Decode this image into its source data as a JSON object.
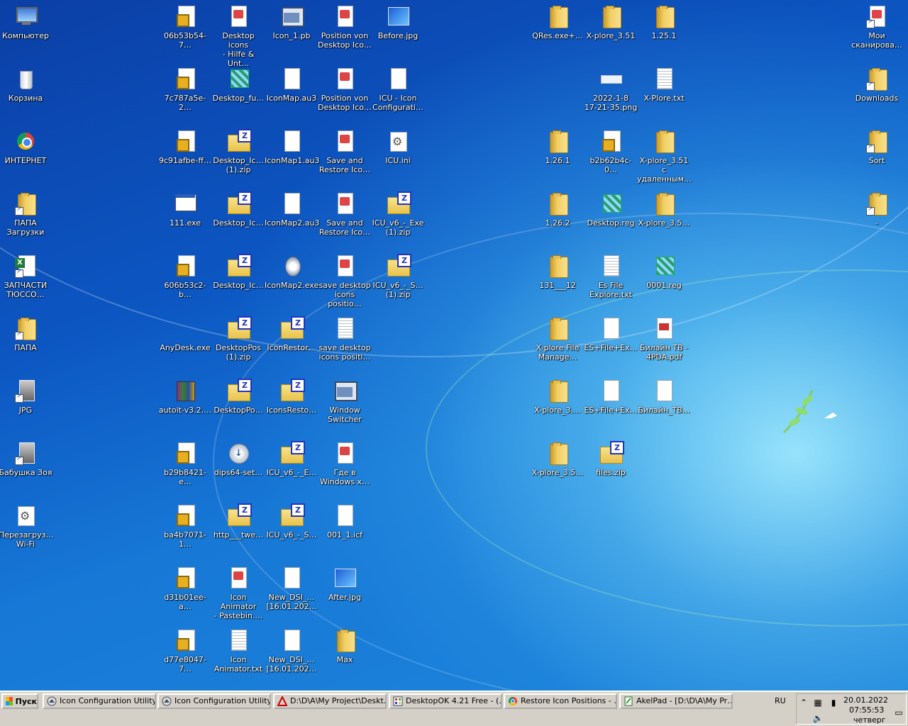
{
  "desktop": {
    "icons": [
      {
        "label": "Компьютер",
        "icon": "computer-icon"
      },
      {
        "label": "Корзина",
        "icon": "recycle-bin-icon"
      },
      {
        "label": "ИНТЕРНЕТ",
        "icon": "chrome-icon"
      },
      {
        "label": "ПАПА\nЗагрузки",
        "icon": "folder-shortcut-icon"
      },
      {
        "label": "ЗАПЧАСТИ\nТЮССО…",
        "icon": "excel-shortcut-icon"
      },
      {
        "label": "ПАПА",
        "icon": "folder-shortcut-icon"
      },
      {
        "label": "JPG",
        "icon": "photo-shortcut-icon"
      },
      {
        "label": "Бабушка Зоя",
        "icon": "photo-shortcut-icon"
      },
      {
        "label": "Перезагруз…\nWi-Fi",
        "icon": "gear-file-icon"
      },
      {
        "label": "06b53b54-7…",
        "icon": "package-icon"
      },
      {
        "label": "7c787a5e-2…",
        "icon": "package-icon"
      },
      {
        "label": "9c91afbe-ff…",
        "icon": "package-icon"
      },
      {
        "label": "111.exe",
        "icon": "exe-icon"
      },
      {
        "label": "606b53c2-b…",
        "icon": "package-icon"
      },
      {
        "label": "AnyDesk.exe",
        "icon": "none"
      },
      {
        "label": "autoit-v3.2.…",
        "icon": "winrar-icon"
      },
      {
        "label": "b29b8421-e…",
        "icon": "package-icon"
      },
      {
        "label": "ba4b7071-1…",
        "icon": "package-icon"
      },
      {
        "label": "d31b01ee-a…",
        "icon": "package-icon"
      },
      {
        "label": "d77e8047-7…",
        "icon": "package-icon"
      },
      {
        "label": "Desktop icons\n- Hilfe & Unt…",
        "icon": "document-icon"
      },
      {
        "label": "Desktop_fu…",
        "icon": "registry-icon"
      },
      {
        "label": "Desktop_Ic…\n(1).zip",
        "icon": "zip-icon"
      },
      {
        "label": "Desktop_Ic…",
        "icon": "zip-icon"
      },
      {
        "label": "Desktop_Ic…",
        "icon": "zip-icon"
      },
      {
        "label": "DesktopPos\n(1).zip",
        "icon": "zip-icon"
      },
      {
        "label": "DesktopPo…",
        "icon": "zip-icon"
      },
      {
        "label": "dips64-set…",
        "icon": "installer-disc-icon"
      },
      {
        "label": "http___twe…",
        "icon": "zip-icon"
      },
      {
        "label": "Icon Animator\n- Pastebin.…",
        "icon": "document-icon"
      },
      {
        "label": "Icon\nAnimator.txt",
        "icon": "text-file-icon"
      },
      {
        "label": "Icon_1.pb",
        "icon": "window-icon"
      },
      {
        "label": "IconMap.au3",
        "icon": "blank-file-icon"
      },
      {
        "label": "IconMap1.au3",
        "icon": "blank-file-icon"
      },
      {
        "label": "IconMap2.au3",
        "icon": "blank-file-icon"
      },
      {
        "label": "IconMap2.exe",
        "icon": "feather-exe-icon"
      },
      {
        "label": "IconRestor…",
        "icon": "zip-icon"
      },
      {
        "label": "IconsResto…",
        "icon": "zip-icon"
      },
      {
        "label": "ICU_v6_-_E…",
        "icon": "zip-icon"
      },
      {
        "label": "ICU_v6_-_S…",
        "icon": "zip-icon"
      },
      {
        "label": "New_DSI_…\n[16.01.202…",
        "icon": "blank-file-icon"
      },
      {
        "label": "New_DSI_…\n[16.01.202…",
        "icon": "blank-file-icon"
      },
      {
        "label": "Position von\nDesktop Ico…",
        "icon": "document-icon"
      },
      {
        "label": "Position von\nDesktop Ico…",
        "icon": "document-icon"
      },
      {
        "label": "Save and\nRestore Ico…",
        "icon": "document-icon"
      },
      {
        "label": "Save and\nRestore Ico…",
        "icon": "document-icon"
      },
      {
        "label": "save desktop\nicons positio…",
        "icon": "document-icon"
      },
      {
        "label": "save desktop\nicons positi…",
        "icon": "text-file-icon"
      },
      {
        "label": "Window\nSwitcher",
        "icon": "window-switcher-icon"
      },
      {
        "label": "Где в\nWindows x…",
        "icon": "document-icon"
      },
      {
        "label": "001_1.icf",
        "icon": "blank-file-icon"
      },
      {
        "label": "After.jpg",
        "icon": "image-icon"
      },
      {
        "label": "Max",
        "icon": "folder-icon"
      },
      {
        "label": "Before.jpg",
        "icon": "image-icon"
      },
      {
        "label": "ICU - Icon\nConfigurati…",
        "icon": "blank-file-icon"
      },
      {
        "label": "ICU.ini",
        "icon": "gear-file-icon"
      },
      {
        "label": "ICU_v6_-_Exe\n(1).zip",
        "icon": "zip-icon"
      },
      {
        "label": "ICU_v6_-_S…\n(1).zip",
        "icon": "zip-icon"
      },
      {
        "label": "QRes.exe+…",
        "icon": "folder-icon"
      },
      {
        "label": "1.26.1",
        "icon": "folder-icon"
      },
      {
        "label": "1.26.2",
        "icon": "folder-icon"
      },
      {
        "label": "131___12",
        "icon": "folder-icon"
      },
      {
        "label": "X-plore File\nManage…",
        "icon": "folder-icon"
      },
      {
        "label": "X-plore_3.…",
        "icon": "folder-icon"
      },
      {
        "label": "X-plore_3.5…",
        "icon": "folder-icon"
      },
      {
        "label": "X-plore_3.51",
        "icon": "folder-icon"
      },
      {
        "label": "2022-1-8\n17-21-35.png",
        "icon": "png-icon"
      },
      {
        "label": "b2b62b4c-0…",
        "icon": "package-icon"
      },
      {
        "label": "Desktop.reg",
        "icon": "registry-icon"
      },
      {
        "label": "Es File\nExplore.txt",
        "icon": "text-file-icon"
      },
      {
        "label": "ES+File+Ex…",
        "icon": "blank-file-icon"
      },
      {
        "label": "ES+File+Ex…",
        "icon": "blank-file-icon"
      },
      {
        "label": "files.zip",
        "icon": "zip-icon"
      },
      {
        "label": "1.25.1",
        "icon": "folder-icon"
      },
      {
        "label": "X-Plore.txt",
        "icon": "text-file-icon"
      },
      {
        "label": "X-plore_3.51 с\nудаленным…",
        "icon": "folder-icon"
      },
      {
        "label": "X-plore_3.5…",
        "icon": "folder-icon"
      },
      {
        "label": "0001.reg",
        "icon": "registry-icon"
      },
      {
        "label": "Билайн ТВ -\n4PDA.pdf",
        "icon": "pdf-icon"
      },
      {
        "label": "Билайн_ТВ…",
        "icon": "blank-file-icon"
      },
      {
        "label": "Мои\nсканирова…",
        "icon": "document-shortcut-icon"
      },
      {
        "label": "Downloads",
        "icon": "folder-shortcut-icon"
      },
      {
        "label": "Sort",
        "icon": "folder-shortcut-icon"
      },
      {
        "label": "-",
        "icon": "folder-shortcut-icon"
      }
    ]
  },
  "taskbar": {
    "start_label": "Пуск",
    "tasks": [
      {
        "label": "Icon Configuration Utility…"
      },
      {
        "label": "Icon Configuration Utility…"
      },
      {
        "label": "D:\\D\\A\\My Project\\Deskt…"
      },
      {
        "label": "DesktopOK 4.21 Free - (…"
      },
      {
        "label": "Restore Icon Positions - …"
      },
      {
        "label": "AkelPad - [D:\\D\\A\\My Pr…"
      }
    ],
    "language": "RU",
    "clock": {
      "date": "20.01.2022",
      "time": "07:55:53",
      "day": "четверг"
    }
  }
}
